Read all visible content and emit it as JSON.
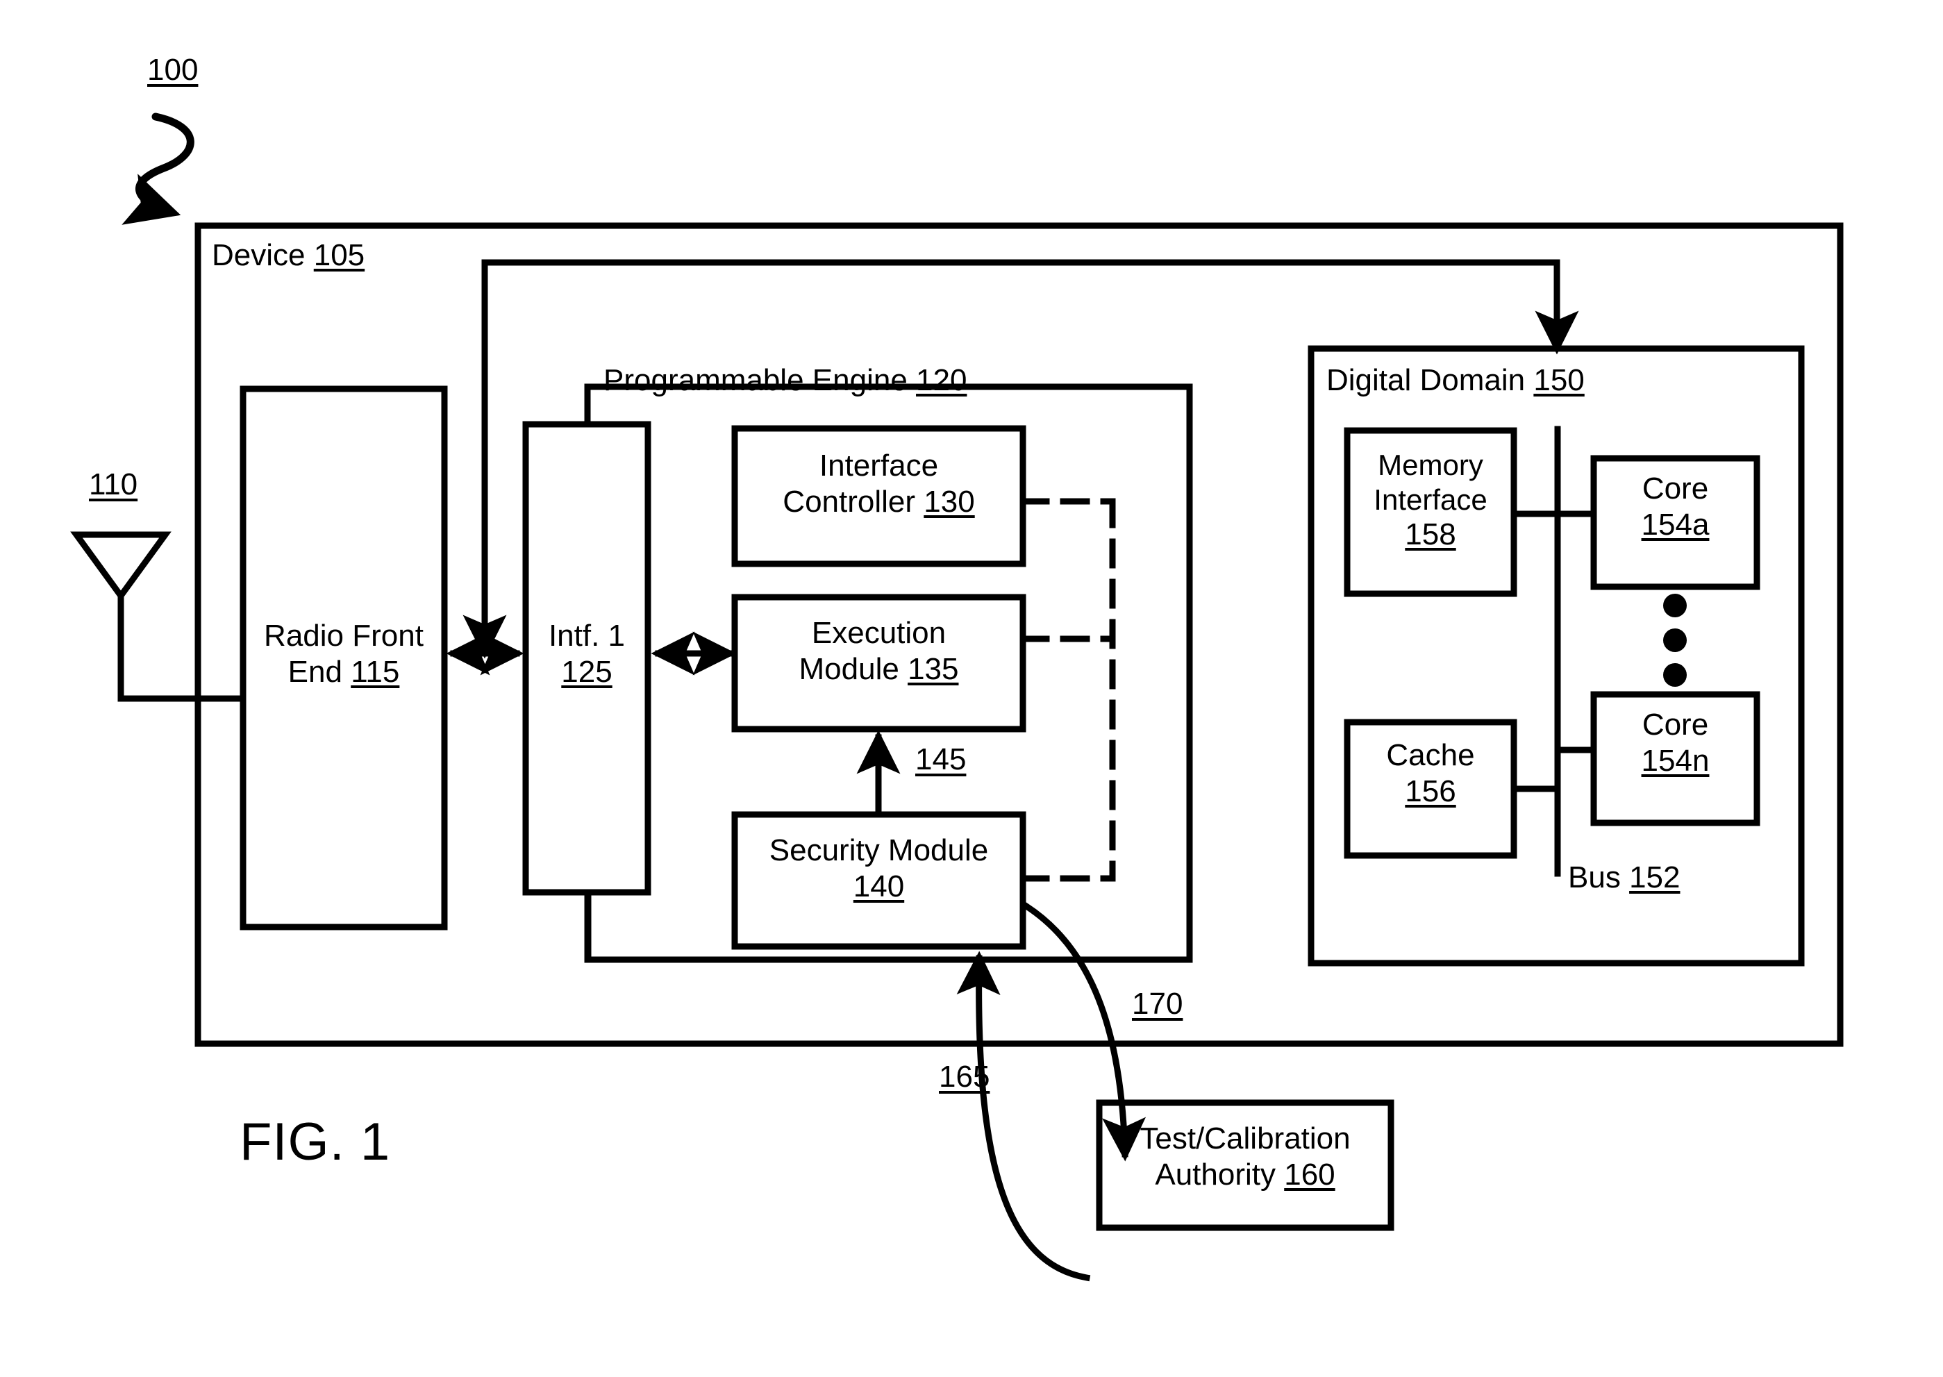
{
  "figure": {
    "caption": "FIG. 1",
    "system_callout": "100"
  },
  "device": {
    "label": "Device",
    "ref": "105"
  },
  "antenna": {
    "callout": "110",
    "icon": "antenna-icon"
  },
  "radio_front_end": {
    "line1": "Radio Front",
    "line2": "End",
    "ref": "115"
  },
  "interface_1": {
    "line1": "Intf. 1",
    "ref": "125"
  },
  "programmable_engine": {
    "label": "Programmable Engine",
    "ref": "120"
  },
  "interface_controller": {
    "line1": "Interface",
    "line2": "Controller",
    "ref": "130"
  },
  "execution_module": {
    "line1": "Execution",
    "line2": "Module",
    "ref": "135"
  },
  "security_module": {
    "line1": "Security Module",
    "ref": "140"
  },
  "signal_145": {
    "callout": "145"
  },
  "digital_domain": {
    "label": "Digital Domain",
    "ref": "150"
  },
  "memory_interface": {
    "line1": "Memory",
    "line2": "Interface",
    "ref": "158"
  },
  "cache": {
    "line1": "Cache",
    "ref": "156"
  },
  "core_a": {
    "line1": "Core",
    "ref": "154a"
  },
  "core_n": {
    "line1": "Core",
    "ref": "154n"
  },
  "bus": {
    "label": "Bus",
    "ref": "152"
  },
  "test_calibration_authority": {
    "line1": "Test/Calibration",
    "line2": "Authority",
    "ref": "160"
  },
  "link_165": {
    "callout": "165"
  },
  "link_170": {
    "callout": "170"
  },
  "colors": {
    "stroke": "#000000",
    "background": "#ffffff"
  }
}
